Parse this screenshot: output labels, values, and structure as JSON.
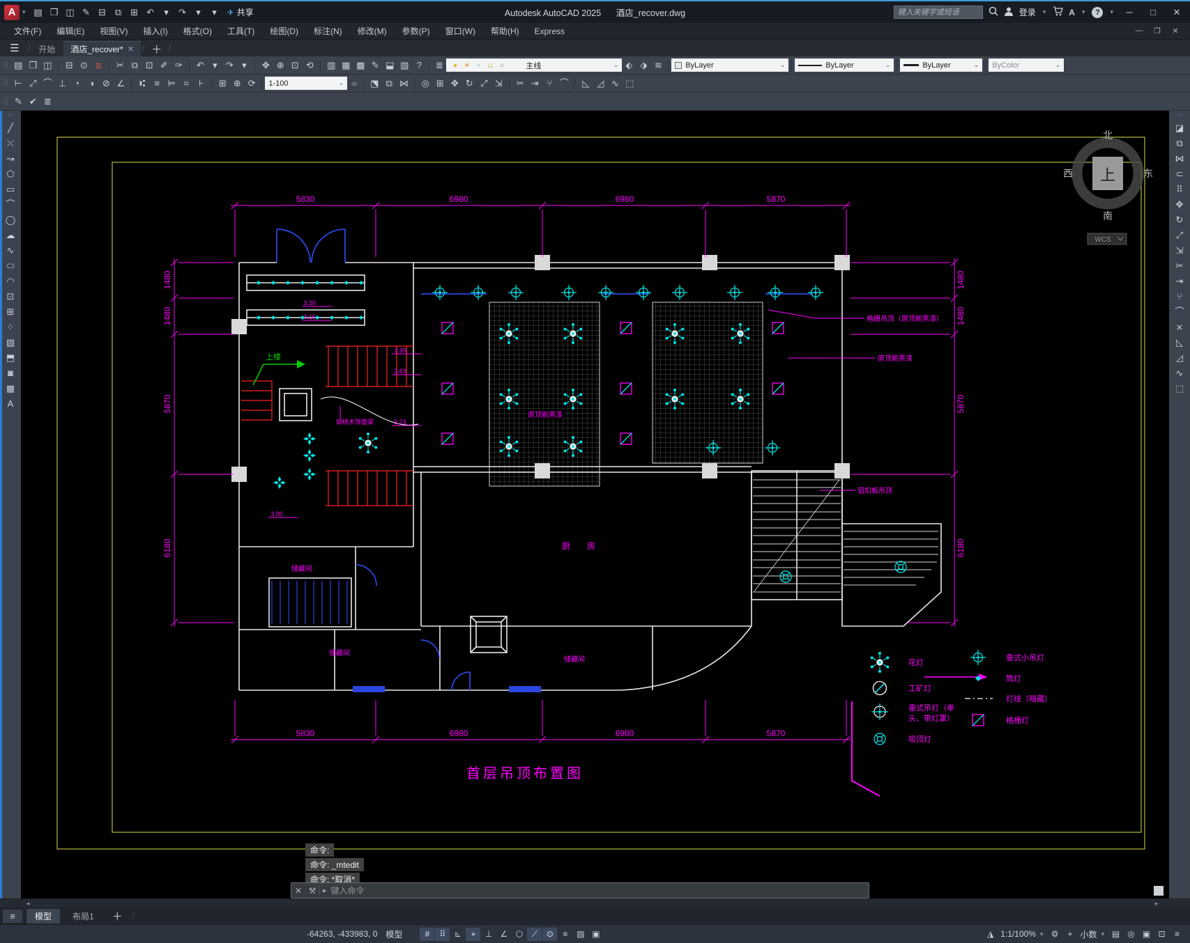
{
  "window": {
    "app_title": "Autodesk AutoCAD 2025",
    "doc_title": "酒店_recover.dwg",
    "search_placeholder": "键入关键字或短语",
    "sign_in": "登录",
    "share": "共享",
    "minimize": "─",
    "maximize": "□",
    "close": "✕",
    "doc_minimize": "—",
    "doc_restore": "❐",
    "doc_close": "✕"
  },
  "menu_bar": {
    "items": [
      "文件(F)",
      "编辑(E)",
      "视图(V)",
      "插入(I)",
      "格式(O)",
      "工具(T)",
      "绘图(D)",
      "标注(N)",
      "修改(M)",
      "参数(P)",
      "窗口(W)",
      "帮助(H)",
      "Express"
    ]
  },
  "file_tabs": {
    "start": "开始",
    "doc": "酒店_recover*",
    "close": "✕",
    "new": "＋"
  },
  "controls": {
    "layer": "主线",
    "color": "ByLayer",
    "linetype": "ByLayer",
    "lineweight": "ByLayer",
    "plot_style": "ByColor",
    "dim_style": "1-100"
  },
  "icons": {
    "qat": [
      {
        "n": "new-file",
        "g": "▤"
      },
      {
        "n": "open-folder",
        "g": "❒"
      },
      {
        "n": "save",
        "g": "◫"
      },
      {
        "n": "save-as",
        "g": "✎"
      },
      {
        "n": "recover-drawing",
        "g": "⊟"
      },
      {
        "n": "open-from-web",
        "g": "⧉"
      },
      {
        "n": "print",
        "g": "⊞"
      },
      {
        "n": "undo",
        "g": "↶"
      },
      {
        "n": "undo-caret",
        "g": "▾"
      },
      {
        "n": "redo",
        "g": "↷"
      },
      {
        "n": "redo-caret",
        "g": "▾"
      },
      {
        "n": "qat-menu",
        "g": "▾"
      }
    ],
    "std": [
      {
        "n": "new-file",
        "g": "▤"
      },
      {
        "n": "open-folder",
        "g": "❒"
      },
      {
        "n": "save",
        "g": "◫"
      },
      {
        "sep": true
      },
      {
        "n": "plot",
        "g": "⊟"
      },
      {
        "n": "plot-preview",
        "g": "⊙"
      },
      {
        "n": "publish-dwf",
        "g": "⧈",
        "c": "#c4544a"
      },
      {
        "sep": true
      },
      {
        "n": "cut-clip",
        "g": "✂"
      },
      {
        "n": "copy-clip",
        "g": "⧉"
      },
      {
        "n": "paste-clip",
        "g": "⊡"
      },
      {
        "n": "match-properties",
        "g": "✐"
      },
      {
        "n": "edit-block",
        "g": "✑"
      },
      {
        "sep": true
      },
      {
        "n": "undo",
        "g": "↶"
      },
      {
        "n": "undo-caret",
        "g": "▾"
      },
      {
        "n": "redo",
        "g": "↷"
      },
      {
        "n": "redo-caret",
        "g": "▾"
      },
      {
        "sep": true
      },
      {
        "n": "pan-realtime",
        "g": "✥"
      },
      {
        "n": "zoom-realtime",
        "g": "⊕"
      },
      {
        "n": "zoom-window",
        "g": "⊡"
      },
      {
        "n": "zoom-previous",
        "g": "⟲"
      },
      {
        "sep": true
      },
      {
        "n": "properties-palette",
        "g": "▥"
      },
      {
        "n": "design-center",
        "g": "▦"
      },
      {
        "n": "tool-palettes",
        "g": "▩"
      },
      {
        "n": "sheet-set-manager",
        "g": "✎"
      },
      {
        "n": "markup-import",
        "g": "⬓"
      },
      {
        "n": "quick-calc",
        "g": "▧"
      },
      {
        "n": "help",
        "g": "?"
      }
    ],
    "layer_panel": [
      {
        "n": "layer-properties-manager",
        "g": "≣"
      }
    ],
    "layer_dd": [
      {
        "n": "layer-on-bulb",
        "g": "●",
        "c": "#e8b33a"
      },
      {
        "n": "layer-thaw-sun",
        "g": "☀",
        "c": "#e8932f"
      },
      {
        "n": "layer-viewport-freeze",
        "g": "▫",
        "c": "#7d96b0"
      },
      {
        "n": "layer-unlock",
        "g": "⊔",
        "c": "#d8c04a"
      },
      {
        "n": "layer-color-swatch",
        "g": "■",
        "c": "#d9d9d9"
      }
    ],
    "layer_tools": [
      {
        "n": "make-object-layer-current",
        "g": "⬖"
      },
      {
        "n": "layer-previous",
        "g": "⬗"
      },
      {
        "n": "layer-states",
        "g": "≋"
      }
    ],
    "dim": [
      {
        "n": "linear-dimension",
        "g": "⊢"
      },
      {
        "n": "aligned-dimension",
        "g": "⤢"
      },
      {
        "n": "arc-length-dimension",
        "g": "⌒"
      },
      {
        "n": "ordinate-dimension",
        "g": "⊥"
      },
      {
        "n": "radius-dimension",
        "g": "◔"
      },
      {
        "n": "jogged-dimension",
        "g": "◑"
      },
      {
        "n": "diameter-dimension",
        "g": "⊘"
      },
      {
        "n": "angular-dimension",
        "g": "∠"
      },
      {
        "sep": true
      },
      {
        "n": "quick-dimension",
        "g": "⑆"
      },
      {
        "n": "baseline-dimension",
        "g": "≡"
      },
      {
        "n": "continue-dimension",
        "g": "⊨"
      },
      {
        "n": "dimension-space",
        "g": "⌗"
      },
      {
        "n": "dimension-break",
        "g": "⊦"
      },
      {
        "sep": true
      },
      {
        "n": "tolerance",
        "g": "⊞"
      },
      {
        "n": "center-mark",
        "g": "⊕"
      },
      {
        "n": "dimension-update",
        "g": "⟳"
      }
    ],
    "dimstyle_btn": [
      {
        "n": "dimension-style-manager",
        "g": "⌯"
      }
    ],
    "modify_row": [
      {
        "n": "erase",
        "g": "⬔"
      },
      {
        "n": "copy",
        "g": "⧉"
      },
      {
        "n": "mirror",
        "g": "⋈"
      },
      {
        "sep": true
      },
      {
        "n": "offset",
        "g": "◎"
      },
      {
        "n": "array",
        "g": "⊞"
      },
      {
        "n": "move",
        "g": "✥"
      },
      {
        "n": "rotate",
        "g": "↻"
      },
      {
        "n": "scale",
        "g": "⤢"
      },
      {
        "n": "stretch",
        "g": "⇲"
      },
      {
        "sep": true
      },
      {
        "n": "trim",
        "g": "✂"
      },
      {
        "n": "extend",
        "g": "⇥"
      },
      {
        "n": "break-at-point",
        "g": "⑂"
      },
      {
        "n": "break",
        "g": "⌒"
      },
      {
        "sep": true
      },
      {
        "n": "chamfer",
        "g": "◺"
      },
      {
        "n": "fillet",
        "g": "◿"
      },
      {
        "n": "blend-curves",
        "g": "∿"
      },
      {
        "n": "explode",
        "g": "⬚"
      }
    ],
    "text_row": [
      {
        "n": "edit-text",
        "g": "✎"
      },
      {
        "n": "spell-check",
        "g": "✔"
      },
      {
        "n": "layer-translate",
        "g": "≣"
      }
    ],
    "draw_left": [
      {
        "n": "line",
        "g": "╱"
      },
      {
        "n": "construction-line",
        "g": "⤫"
      },
      {
        "n": "polyline",
        "g": "↝"
      },
      {
        "n": "polygon",
        "g": "⬠"
      },
      {
        "n": "rectangle",
        "g": "▭"
      },
      {
        "n": "arc",
        "g": "⌒"
      },
      {
        "n": "circle",
        "g": "◯"
      },
      {
        "n": "revision-cloud",
        "g": "☁"
      },
      {
        "n": "spline",
        "g": "∿"
      },
      {
        "n": "ellipse",
        "g": "⬭"
      },
      {
        "n": "ellipse-arc",
        "g": "◠"
      },
      {
        "n": "insert-block",
        "g": "⊡"
      },
      {
        "n": "create-block",
        "g": "⊞"
      },
      {
        "n": "point",
        "g": "⁘"
      },
      {
        "n": "hatch",
        "g": "▨"
      },
      {
        "n": "gradient",
        "g": "⬒"
      },
      {
        "n": "region",
        "g": "◙"
      },
      {
        "n": "table",
        "g": "▦"
      },
      {
        "n": "multiline-text",
        "g": "A"
      }
    ],
    "modify_right": [
      {
        "n": "erase",
        "g": "◪"
      },
      {
        "n": "copy",
        "g": "⧉"
      },
      {
        "n": "mirror",
        "g": "⋈"
      },
      {
        "n": "offset",
        "g": "⊂"
      },
      {
        "n": "array",
        "g": "⠿"
      },
      {
        "n": "move",
        "g": "✥"
      },
      {
        "n": "rotate",
        "g": "↻"
      },
      {
        "n": "scale",
        "g": "⤢"
      },
      {
        "n": "stretch",
        "g": "⇲"
      },
      {
        "n": "trim",
        "g": "✂"
      },
      {
        "n": "extend",
        "g": "⇥"
      },
      {
        "n": "break-at-point",
        "g": "⑂"
      },
      {
        "n": "break",
        "g": "⌒"
      },
      {
        "n": "join",
        "g": "⨯"
      },
      {
        "n": "chamfer",
        "g": "◺"
      },
      {
        "n": "fillet",
        "g": "◿"
      },
      {
        "n": "spline-edit",
        "g": "∿"
      },
      {
        "n": "explode",
        "g": "⬚"
      }
    ],
    "status_left": [
      {
        "n": "grid-display",
        "g": "#",
        "a": 1
      },
      {
        "n": "snap-mode",
        "g": "⠿",
        "a": 1
      },
      {
        "n": "infer-constraints",
        "g": "⊾"
      },
      {
        "n": "dynamic-input",
        "g": "⌖",
        "a": 1
      },
      {
        "n": "ortho-mode",
        "g": "⊥"
      },
      {
        "n": "polar-tracking",
        "g": "∠"
      },
      {
        "n": "isometric-drafting",
        "g": "⬡"
      },
      {
        "n": "object-snap-tracking",
        "g": "⟋",
        "a": 1
      },
      {
        "n": "object-snap",
        "g": "⊙",
        "a": 1
      },
      {
        "n": "lineweight-display",
        "g": "≡"
      },
      {
        "n": "transparency",
        "g": "▨"
      },
      {
        "n": "selection-cycling",
        "g": "▣"
      }
    ],
    "status_right_a": [
      {
        "n": "annotation-visibility",
        "g": "◮"
      }
    ],
    "status_right_b": [
      {
        "n": "workspace-switching",
        "g": "⚙"
      },
      {
        "n": "annotation-scale-add",
        "g": "+"
      }
    ],
    "status_right_c": [
      {
        "n": "quick-properties",
        "g": "▤"
      },
      {
        "n": "isolate-objects",
        "g": "◎"
      },
      {
        "n": "graphics-performance",
        "g": "▣"
      },
      {
        "n": "clean-screen",
        "g": "⊡"
      },
      {
        "n": "customization-menu",
        "g": "≡"
      }
    ]
  },
  "drawing": {
    "title": "首层吊顶布置图",
    "compass": {
      "north": "北",
      "south": "南",
      "west": "西",
      "east": "东",
      "up": "上",
      "wcs": "WCS"
    },
    "dim_top": [
      "5830",
      "6980",
      "6980",
      "5870"
    ],
    "dim_bottom": [
      "5830",
      "6980",
      "6980",
      "5870"
    ],
    "dim_left": [
      "1480",
      "1480",
      "5870",
      "6180"
    ],
    "dim_right": [
      "1480",
      "1480",
      "5870",
      "6180"
    ],
    "annotations": {
      "grille_ceiling": "格栅吊顶（原顶刷黑漆）",
      "painted_black_1": "原顶刷黑漆",
      "painted_black_2": "原顶刷黑漆",
      "aluminum_panel": "铝扣板吊顶",
      "walnut_beam": "胡桃木饰面梁",
      "storage_1": "储藏间",
      "storage_2": "储藏间",
      "storage_3": "储藏间",
      "kitchen": "厨　　房",
      "upstairs": "上楼",
      "elev_1": "3.30",
      "elev_2": "3.10",
      "elev_3": "3.30",
      "elev_4": "3.63",
      "elev_5": "3.74",
      "elev_6": "3.00"
    },
    "legend": {
      "items": [
        {
          "symbol": "chandelier",
          "lines": [
            "花灯"
          ]
        },
        {
          "symbol": "industrial-lamp",
          "lines": [
            "工矿灯"
          ]
        },
        {
          "symbol": "pendant-lamp-single",
          "lines": [
            "垂式吊灯（单",
            "头、带灯罩）"
          ]
        },
        {
          "symbol": "ceiling-lamp",
          "lines": [
            "吸顶灯"
          ]
        },
        {
          "symbol": "small-pendant-lamp",
          "lines": [
            "垂式小吊灯"
          ]
        },
        {
          "symbol": "downlight",
          "lines": [
            "筒灯"
          ]
        },
        {
          "symbol": "concealed-light-cove",
          "lines": [
            "灯线（暗藏）"
          ]
        },
        {
          "symbol": "grille-light",
          "lines": [
            "格栅灯"
          ]
        }
      ]
    }
  },
  "command": {
    "history": [
      "命令:",
      "命令: _mtedit",
      "命令: *取消*"
    ],
    "input_placeholder": "键入命令"
  },
  "layout_tabs": {
    "model": "模型",
    "layout1": "布局1"
  },
  "status_bar": {
    "coordinates": "-64263, -433983, 0",
    "model": "模型",
    "viewport_scale": "1:1/100%",
    "units": "小数"
  },
  "colors": {
    "canvas_bg": "#000000",
    "dimension_magenta": "#ff00ff",
    "symbol_cyan": "#00e8e8",
    "wall_white": "#e8e8e8",
    "door_blue": "#2b46e0",
    "stair_red": "#ff2222",
    "frame_yellow": "#b9b93c",
    "upstairs_green": "#00d000",
    "titlebar_accent": "#3f9bd8"
  }
}
